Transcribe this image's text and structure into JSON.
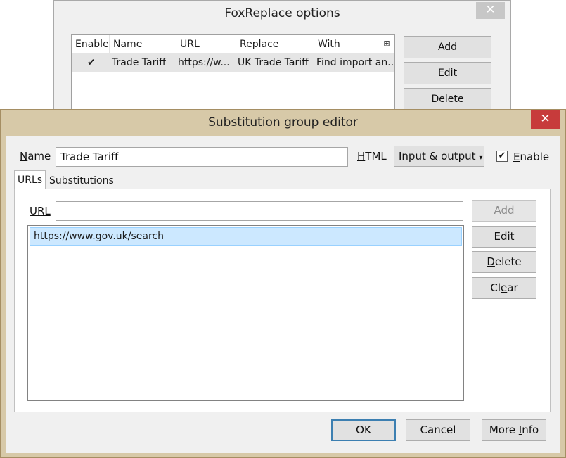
{
  "bg_window": {
    "title": "FoxReplace options",
    "close_glyph": "✕",
    "table": {
      "headers": [
        "Enable",
        "Name",
        "URL",
        "Replace",
        "With"
      ],
      "rows": [
        {
          "enable": "✔",
          "name": "Trade Tariff",
          "url": "https://w...",
          "replace": "UK Trade Tariff",
          "with": "Find import an..."
        }
      ],
      "column_picker_glyph": "⊞"
    },
    "buttons": {
      "add": {
        "mnemonic": "A",
        "rest": "dd"
      },
      "edit": {
        "mnemonic": "E",
        "rest": "dit"
      },
      "delete": {
        "mnemonic": "D",
        "rest": "elete"
      }
    }
  },
  "dialog": {
    "title": "Substitution group editor",
    "close_glyph": "✕",
    "name_label": {
      "mnemonic": "N",
      "rest": "ame"
    },
    "name_value": "Trade Tariff",
    "html_label": {
      "mnemonic": "H",
      "rest": "TML"
    },
    "html_select_value": "Input & output",
    "html_select_arrow": "▾",
    "enable_checkbox_glyph": "✔",
    "enable_label": {
      "mnemonic": "E",
      "rest": "nable"
    },
    "tabs": [
      {
        "label": "URLs",
        "active": true
      },
      {
        "label": "Substitutions",
        "active": false
      }
    ],
    "url_label": {
      "mnemonic": "URL",
      "rest": ""
    },
    "url_input_value": "",
    "url_list": [
      "https://www.gov.uk/search"
    ],
    "side_buttons": {
      "add": {
        "pre": "",
        "mnemonic": "A",
        "rest": "dd",
        "disabled": true
      },
      "edit": {
        "pre": "Ed",
        "mnemonic": "i",
        "rest": "t"
      },
      "delete": {
        "pre": "",
        "mnemonic": "D",
        "rest": "elete"
      },
      "clear": {
        "pre": "Cl",
        "mnemonic": "e",
        "rest": "ar"
      }
    },
    "footer_buttons": {
      "ok": "OK",
      "cancel": "Cancel",
      "more_info": {
        "pre": "More ",
        "mnemonic": "I",
        "rest": "nfo"
      }
    }
  },
  "colors": {
    "dialog_frame": "#d7c9a8",
    "close_red": "#c73b3b",
    "selection": "#cce8ff"
  }
}
